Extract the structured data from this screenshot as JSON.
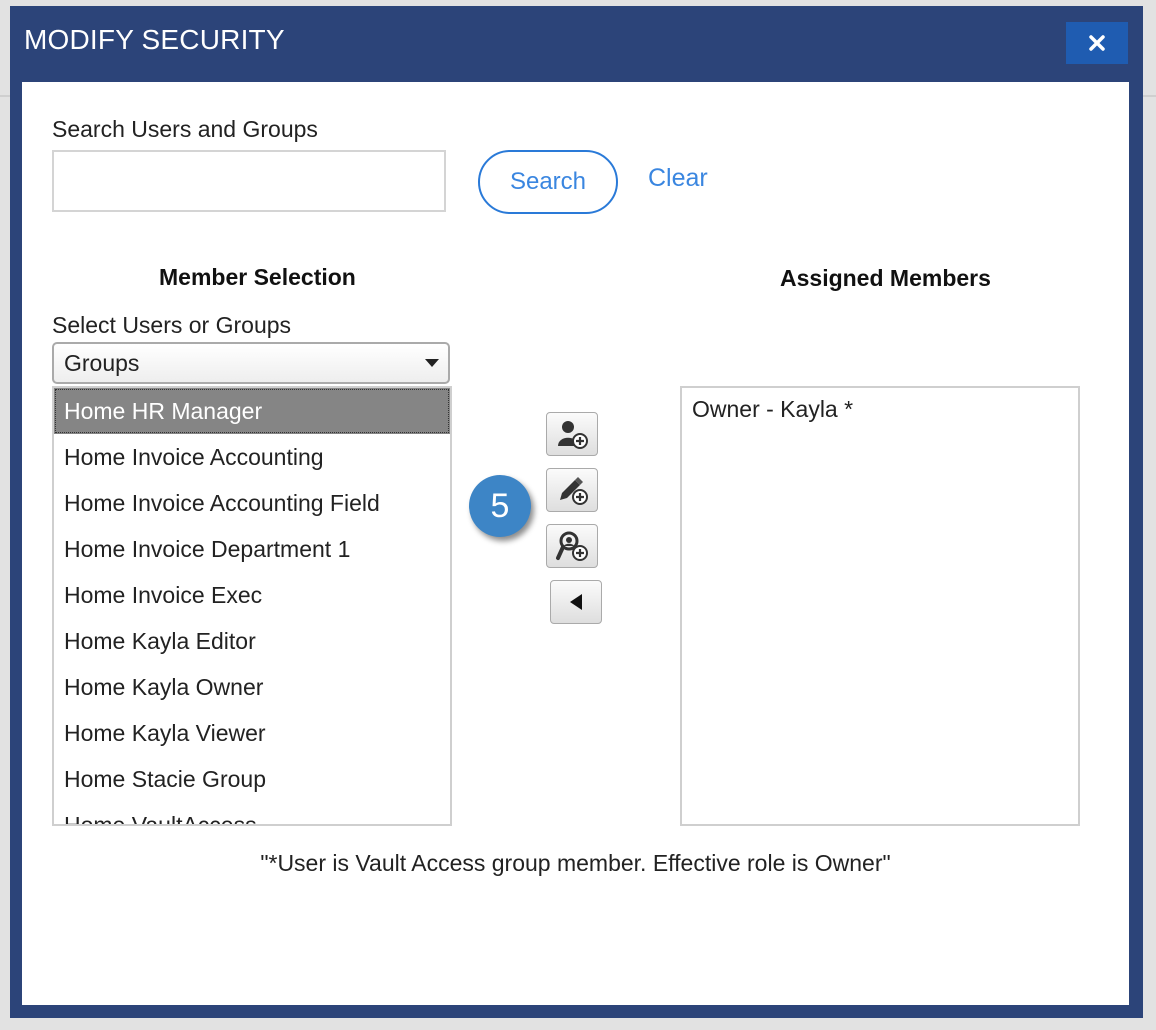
{
  "dialog": {
    "title": "MODIFY SECURITY",
    "close_icon": "close-icon"
  },
  "search": {
    "label": "Search Users and Groups",
    "value": "",
    "placeholder": "",
    "search_button": "Search",
    "clear_link": "Clear"
  },
  "member_selection": {
    "heading": "Member Selection",
    "select_label": "Select Users or Groups",
    "select_value": "Groups",
    "items": [
      {
        "label": "Home HR Manager",
        "selected": true
      },
      {
        "label": "Home Invoice Accounting",
        "selected": false
      },
      {
        "label": "Home Invoice Accounting Field",
        "selected": false
      },
      {
        "label": "Home Invoice Department 1",
        "selected": false
      },
      {
        "label": "Home Invoice Exec",
        "selected": false
      },
      {
        "label": "Home Kayla Editor",
        "selected": false
      },
      {
        "label": "Home Kayla Owner",
        "selected": false
      },
      {
        "label": "Home Kayla Viewer",
        "selected": false
      },
      {
        "label": "Home Stacie Group",
        "selected": false
      },
      {
        "label": "Home VaultAccess",
        "selected": false
      }
    ]
  },
  "actions": {
    "buttons": [
      {
        "icon": "add-viewer-icon"
      },
      {
        "icon": "add-editor-icon"
      },
      {
        "icon": "add-owner-icon"
      },
      {
        "icon": "remove-arrow-icon"
      }
    ]
  },
  "callout": {
    "step_number": "5"
  },
  "assigned_members": {
    "heading": "Assigned Members",
    "items": [
      "Owner - Kayla *"
    ]
  },
  "footnote": "\"*User is Vault Access group member. Effective role is Owner\"",
  "colors": {
    "header_bg": "#2c4479",
    "close_bg": "#1f5cb1",
    "link": "#3a86e0",
    "selected_item_bg": "#858585",
    "badge": "#3d85c6"
  }
}
